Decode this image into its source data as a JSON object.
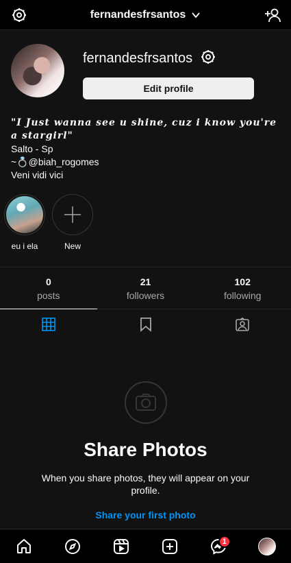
{
  "header": {
    "username": "fernandesfrsantos"
  },
  "profile": {
    "username": "fernandesfrsantos",
    "edit_label": "Edit profile"
  },
  "bio": {
    "line1": "\"I Just wanna see u shine, cuz i know you're a stargirl\"",
    "line2": "Salto - Sp",
    "line3": "~💍@biah_rogomes",
    "line4": "Veni vidi vici"
  },
  "highlights": [
    {
      "label": "eu i ela"
    },
    {
      "label": "New"
    }
  ],
  "stats": [
    {
      "value": "0",
      "label": "posts"
    },
    {
      "value": "21",
      "label": "followers"
    },
    {
      "value": "102",
      "label": "following"
    }
  ],
  "empty_state": {
    "headline": "Share Photos",
    "subtext": "When you share photos, they will appear on your profile.",
    "cta": "Share your first photo"
  },
  "nav": {
    "messages_badge": "1"
  },
  "colors": {
    "accent": "#0095f6",
    "badge": "#ff3040",
    "active_tab_icon": "#0095f6"
  },
  "icons": [
    "settings-icon",
    "chevron-down-icon",
    "add-user-icon",
    "grid-icon",
    "bookmark-icon",
    "tagged-icon",
    "camera-icon",
    "home-icon",
    "explore-icon",
    "reels-icon",
    "create-icon",
    "messenger-icon"
  ]
}
